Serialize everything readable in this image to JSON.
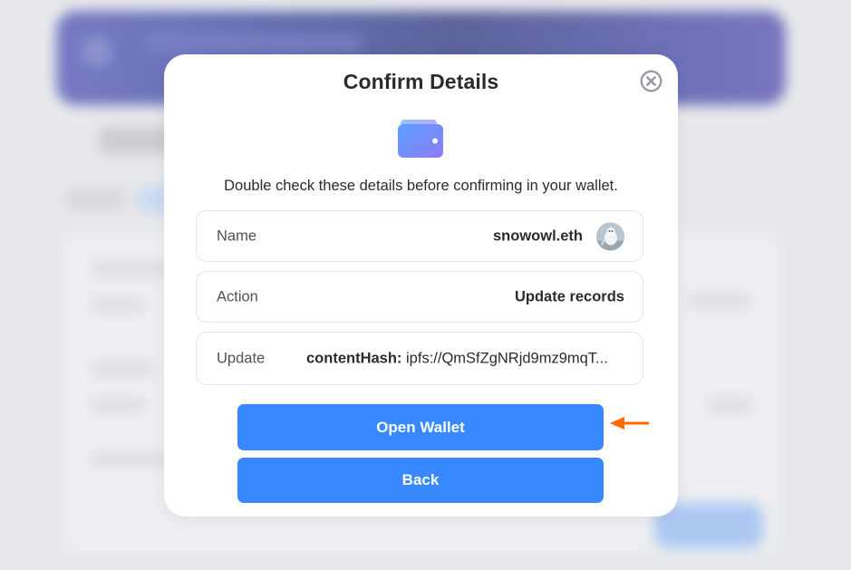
{
  "modal": {
    "title": "Confirm Details",
    "close_icon": "close-circle-icon",
    "wallet_icon": "wallet-icon",
    "subtitle": "Double check these details before confirming in your wallet.",
    "rows": [
      {
        "label": "Name",
        "value": "snowowl.eth",
        "avatar": "owl-avatar"
      },
      {
        "label": "Action",
        "value": "Update records"
      },
      {
        "label": "Update",
        "key": "contentHash:",
        "value": "ipfs://QmSfZgNRjd9mz9mqT..."
      }
    ],
    "buttons": {
      "open_wallet": "Open Wallet",
      "back": "Back"
    }
  },
  "colors": {
    "primary_button": "#3889ff",
    "annotation_arrow": "#ff6a00",
    "wallet_gradient_start": "#5aa0ff",
    "wallet_gradient_end": "#8e7cf7"
  }
}
